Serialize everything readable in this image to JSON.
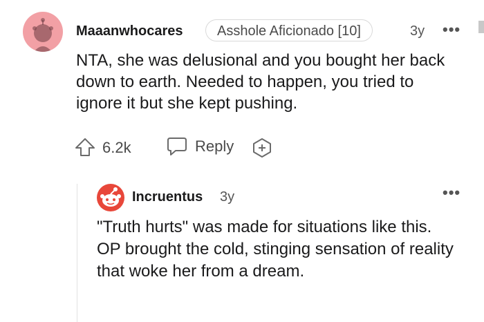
{
  "comment": {
    "username": "Maaanwhocares",
    "flair": "Asshole Aficionado [10]",
    "age": "3y",
    "body": "NTA, she was delusional and you bought her back down to earth. Needed to happen, you tried to ignore it but she kept pushing.",
    "score": "6.2k",
    "reply_label": "Reply",
    "more_label": "•••"
  },
  "reply": {
    "username": "Incruentus",
    "age": "3y",
    "body": "\"Truth hurts\" was made for situations like this. OP brought the cold, stinging sensation of reality that woke her from a dream.",
    "more_label": "•••"
  },
  "icons": {
    "avatar1": "snoo-avatar-pink",
    "avatar2": "snoo-avatar-red",
    "upvote": "upvote-arrow-icon",
    "reply": "speech-bubble-icon",
    "award": "award-plus-icon",
    "more": "ellipsis-icon"
  },
  "colors": {
    "avatar1_bg": "#f2a0a5",
    "avatar2_bg": "#e8473a",
    "text": "#1a1a1b",
    "meta": "#4a4a4a"
  }
}
